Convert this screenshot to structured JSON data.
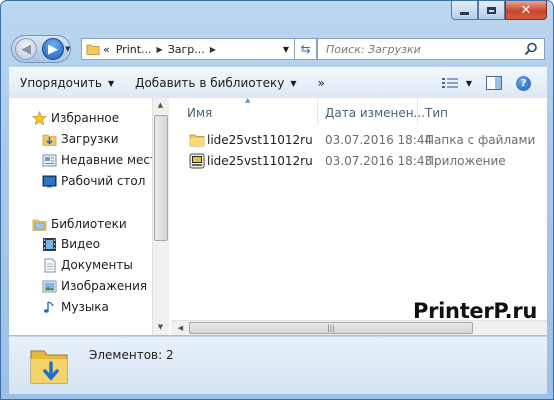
{
  "address": {
    "breadcrumbs": [
      "Print...",
      "Загр..."
    ],
    "overflow": "«"
  },
  "search": {
    "placeholder": "Поиск: Загрузки"
  },
  "toolbar": {
    "organize": "Упорядочить",
    "add_library": "Добавить в библиотеку",
    "more": "»"
  },
  "sidebar": {
    "favorites": {
      "header": "Избранное",
      "items": [
        {
          "label": "Загрузки",
          "icon": "downloads-folder-icon"
        },
        {
          "label": "Недавние места",
          "icon": "recent-places-icon"
        },
        {
          "label": "Рабочий стол",
          "icon": "desktop-icon"
        }
      ]
    },
    "libraries": {
      "header": "Библиотеки",
      "items": [
        {
          "label": "Видео",
          "icon": "video-icon"
        },
        {
          "label": "Документы",
          "icon": "documents-icon"
        },
        {
          "label": "Изображения",
          "icon": "pictures-icon"
        },
        {
          "label": "Музыка",
          "icon": "music-icon"
        }
      ]
    }
  },
  "columns": [
    "Имя",
    "Дата изменен...",
    "Тип"
  ],
  "files": [
    {
      "name": "lide25vst11012ru",
      "date": "03.07.2016 18:44",
      "type": "Папка с файлами",
      "icon": "folder-icon"
    },
    {
      "name": "lide25vst11012ru",
      "date": "03.07.2016 18:43",
      "type": "Приложение",
      "icon": "application-icon"
    }
  ],
  "status": {
    "count": "Элементов: 2"
  },
  "watermark": "PrinterP.ru",
  "colors": {
    "accent": "#2c6fc4",
    "window_frame": "#a9c9ea",
    "folder": "#f2c95a"
  }
}
